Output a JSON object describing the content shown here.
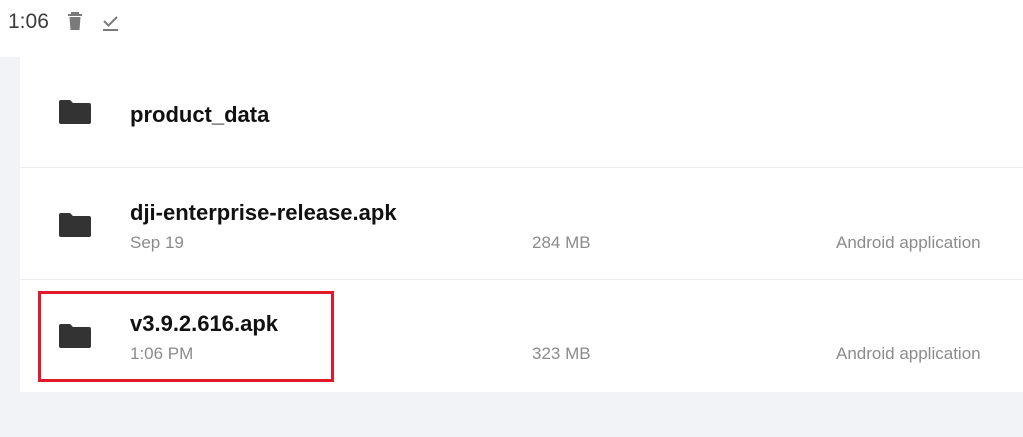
{
  "status_bar": {
    "time": "1:06",
    "icons": [
      "trash-icon",
      "download-done-icon"
    ]
  },
  "files": [
    {
      "icon": "folder-icon",
      "name": "product_data",
      "date": "",
      "size": "",
      "type": ""
    },
    {
      "icon": "folder-icon",
      "name": "dji-enterprise-release.apk",
      "date": "Sep 19",
      "size": "284 MB",
      "type": "Android application"
    },
    {
      "icon": "folder-icon",
      "name": "v3.9.2.616.apk",
      "date": "1:06 PM",
      "size": "323 MB",
      "type": "Android application",
      "highlighted": true
    }
  ],
  "colors": {
    "highlight": "#e0192b",
    "background": "#f2f3f7",
    "list_background": "#ffffff",
    "primary_text": "#111111",
    "secondary_text": "#8b8b8b",
    "icon": "#333333"
  }
}
